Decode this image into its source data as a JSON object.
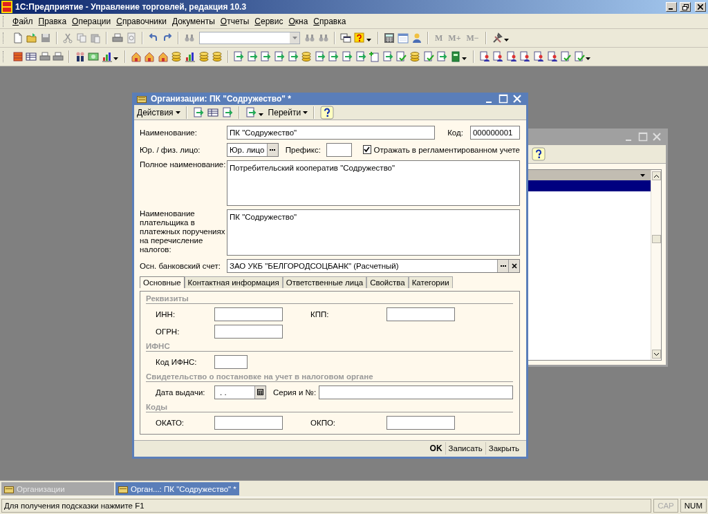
{
  "app": {
    "title": "1С:Предприятие - Управление торговлей, редакция 10.3"
  },
  "menu": [
    {
      "label": "Файл"
    },
    {
      "label": "Правка"
    },
    {
      "label": "Операции"
    },
    {
      "label": "Справочники"
    },
    {
      "label": "Документы"
    },
    {
      "label": "Отчеты"
    },
    {
      "label": "Сервис"
    },
    {
      "label": "Окна"
    },
    {
      "label": "Справка"
    }
  ],
  "toolbar": {
    "memory_buttons": [
      {
        "label": "M",
        "disabled": true
      },
      {
        "label": "M+",
        "disabled": true
      },
      {
        "label": "M−",
        "disabled": true
      }
    ]
  },
  "back_window": {
    "active": false,
    "rows": [
      {
        "selected": true
      }
    ]
  },
  "dialog": {
    "title": "Организации: ПК \"Содружество\" *",
    "active": true,
    "toolbar": {
      "actions": "Действия",
      "goto": "Перейти"
    },
    "fields": {
      "name_label": "Наименование:",
      "name": "ПК \"Содружество\"",
      "code_label": "Код:",
      "code": "000000001",
      "type_label": "Юр. / физ. лицо:",
      "type": "Юр. лицо",
      "prefix_label": "Префикс:",
      "regulated": {
        "label": "Отражать в регламентированном учете",
        "checked": true
      },
      "full_name_label": "Полное наименование:",
      "full_name": "Потребительский кооператив \"Содружество\"",
      "payer_label": "Наименование плательщика в платежных поручениях на перечисление налогов:",
      "payer": "ПК \"Содружество\"",
      "bank_label": "Осн. банковский счет:",
      "bank": "ЗАО УКБ \"БЕЛГОРОДСОЦБАНК\" (Расчетный)"
    },
    "tabs": [
      {
        "label": "Основные",
        "selected": true
      },
      {
        "label": "Контактная информация",
        "selected": false
      },
      {
        "label": "Ответственные лица",
        "selected": false
      },
      {
        "label": "Свойства",
        "selected": false
      },
      {
        "label": "Категории",
        "selected": false
      }
    ],
    "sections": [
      {
        "title": "Реквизиты",
        "rows": [
          [
            {
              "label": "ИНН:",
              "kind": "text"
            },
            {
              "label": "КПП:",
              "kind": "text"
            }
          ],
          [
            {
              "label": "ОГРН:",
              "kind": "text"
            }
          ]
        ]
      },
      {
        "title": "ИФНС",
        "rows": [
          [
            {
              "label": "Код ИФНС:",
              "kind": "short"
            }
          ]
        ]
      },
      {
        "title": "Свидетельство о постановке на учет в налоговом органе",
        "rows": [
          [
            {
              "label": "Дата выдачи:",
              "kind": "date",
              "value": ". ."
            },
            {
              "label": "Серия и №:",
              "kind": "wide"
            }
          ]
        ]
      },
      {
        "title": "Коды",
        "rows": [
          [
            {
              "label": "ОКАТО:",
              "kind": "text"
            },
            {
              "label": "ОКПО:",
              "kind": "text"
            }
          ]
        ]
      }
    ],
    "buttons": [
      {
        "label": "OK",
        "default": true
      },
      {
        "label": "Записать",
        "default": false
      },
      {
        "label": "Закрыть",
        "default": false
      }
    ]
  },
  "taskbar": [
    {
      "label": "Организации",
      "selected": false
    },
    {
      "label": "Орган...: ПК \"Содружество\" *",
      "selected": true
    }
  ],
  "status": {
    "hint": "Для получения подсказки нажмите F1",
    "indicators": [
      {
        "label": "CAP",
        "on": false
      },
      {
        "label": "NUM",
        "on": true
      }
    ]
  }
}
